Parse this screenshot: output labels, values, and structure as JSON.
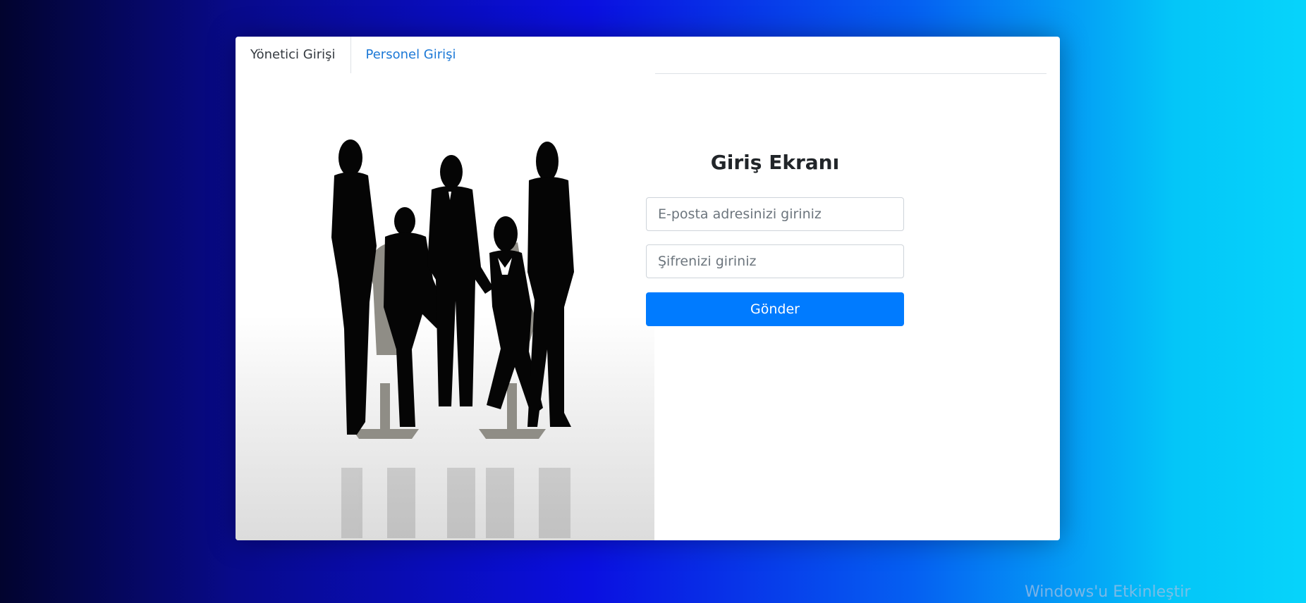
{
  "tabs": {
    "admin_label": "Yönetici Girişi",
    "staff_label": "Personel Girişi"
  },
  "form": {
    "title": "Giriş Ekranı",
    "email_placeholder": "E-posta adresinizi giriniz",
    "email_value": "",
    "password_placeholder": "Şifrenizi giriniz",
    "password_value": "",
    "submit_label": "Gönder"
  },
  "image": {
    "subject": "business-team-silhouette"
  },
  "watermark": {
    "text": "Windows'u Etkinleştir"
  },
  "colors": {
    "primary": "#007bff",
    "link": "#1b78d6",
    "background_left": "#02042e",
    "background_mid": "#0a0fe0",
    "background_right": "#06d4fb"
  }
}
